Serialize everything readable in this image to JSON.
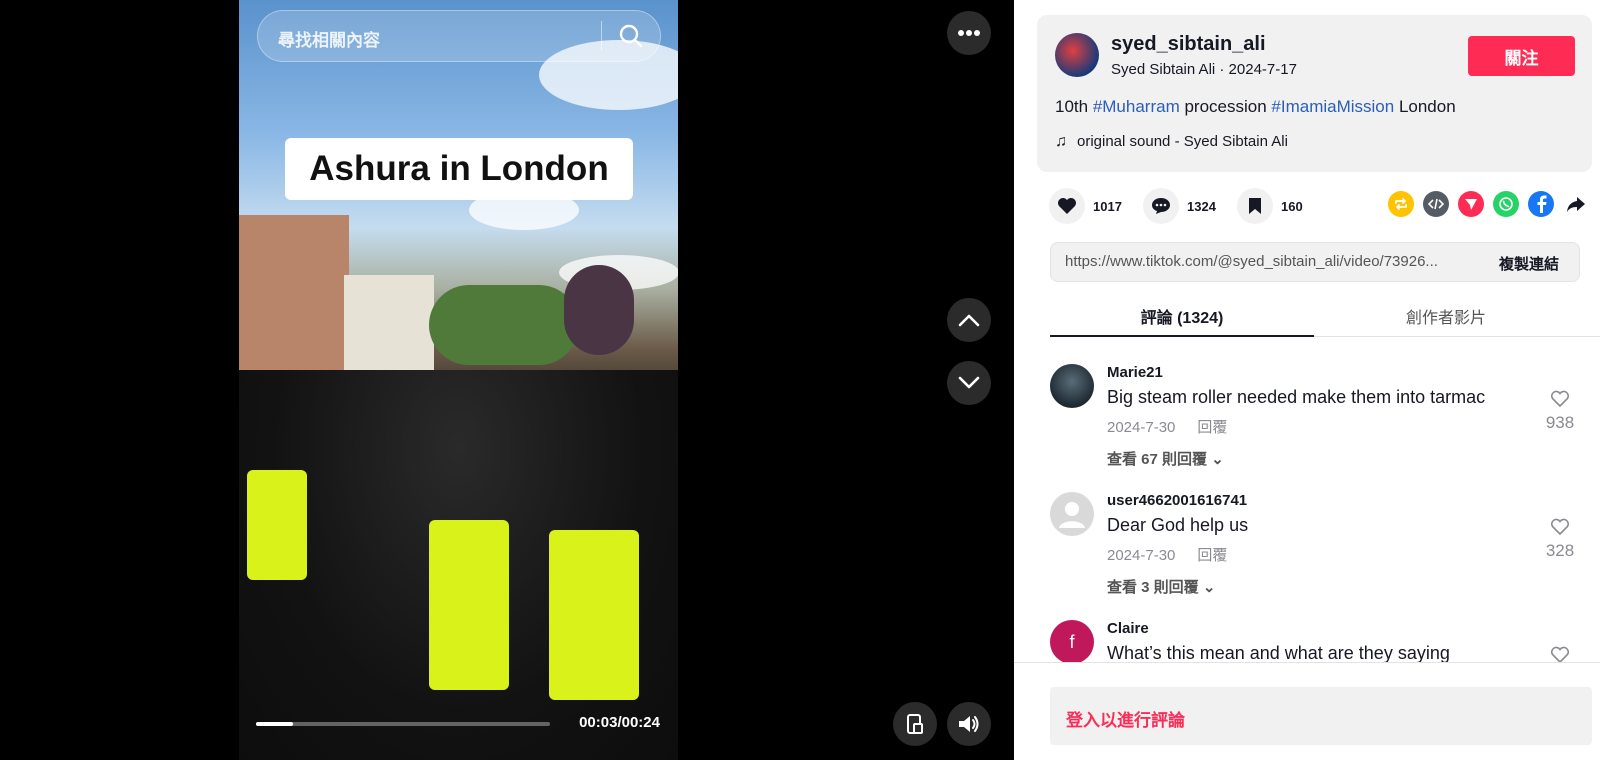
{
  "video": {
    "search_placeholder": "尋找相關內容",
    "caption": "Ashura in London",
    "time": "00:03/00:24",
    "progress": 0.125
  },
  "post": {
    "username": "syed_sibtain_ali",
    "nickname_date": "Syed Sibtain Ali · 2024-7-17",
    "follow_label": "關注",
    "desc_pre": "10th ",
    "tag1": "#Muharram",
    "desc_mid": " procession ",
    "tag2": "#ImamiaMission",
    "desc_post": " London",
    "sound": "original sound - Syed Sibtain Ali"
  },
  "actions": {
    "likes": "1017",
    "comments": "1324",
    "saves": "160"
  },
  "share_colors": {
    "repost": "#ffc300",
    "embed": "#555c66",
    "send": "#fe2c55",
    "whatsapp": "#25d366",
    "facebook": "#1877f2"
  },
  "link": {
    "url": "https://www.tiktok.com/@syed_sibtain_ali/video/73926...",
    "copy_label": "複製連結"
  },
  "tabs": {
    "comments": "評論 (1324)",
    "creator": "創作者影片"
  },
  "comments": [
    {
      "user": "Marie21",
      "text": "Big steam roller needed make them into tarmac",
      "date": "2024-7-30",
      "reply": "回覆",
      "more": "查看 67 則回覆",
      "likes": "938"
    },
    {
      "user": "user4662001616741",
      "text": "Dear God help us",
      "date": "2024-7-30",
      "reply": "回覆",
      "more": "查看 3 則回覆",
      "likes": "328"
    },
    {
      "user": "Claire",
      "initial": "f",
      "text": "What’s this mean and what are they saying"
    }
  ],
  "login_label": "登入以進行評論"
}
